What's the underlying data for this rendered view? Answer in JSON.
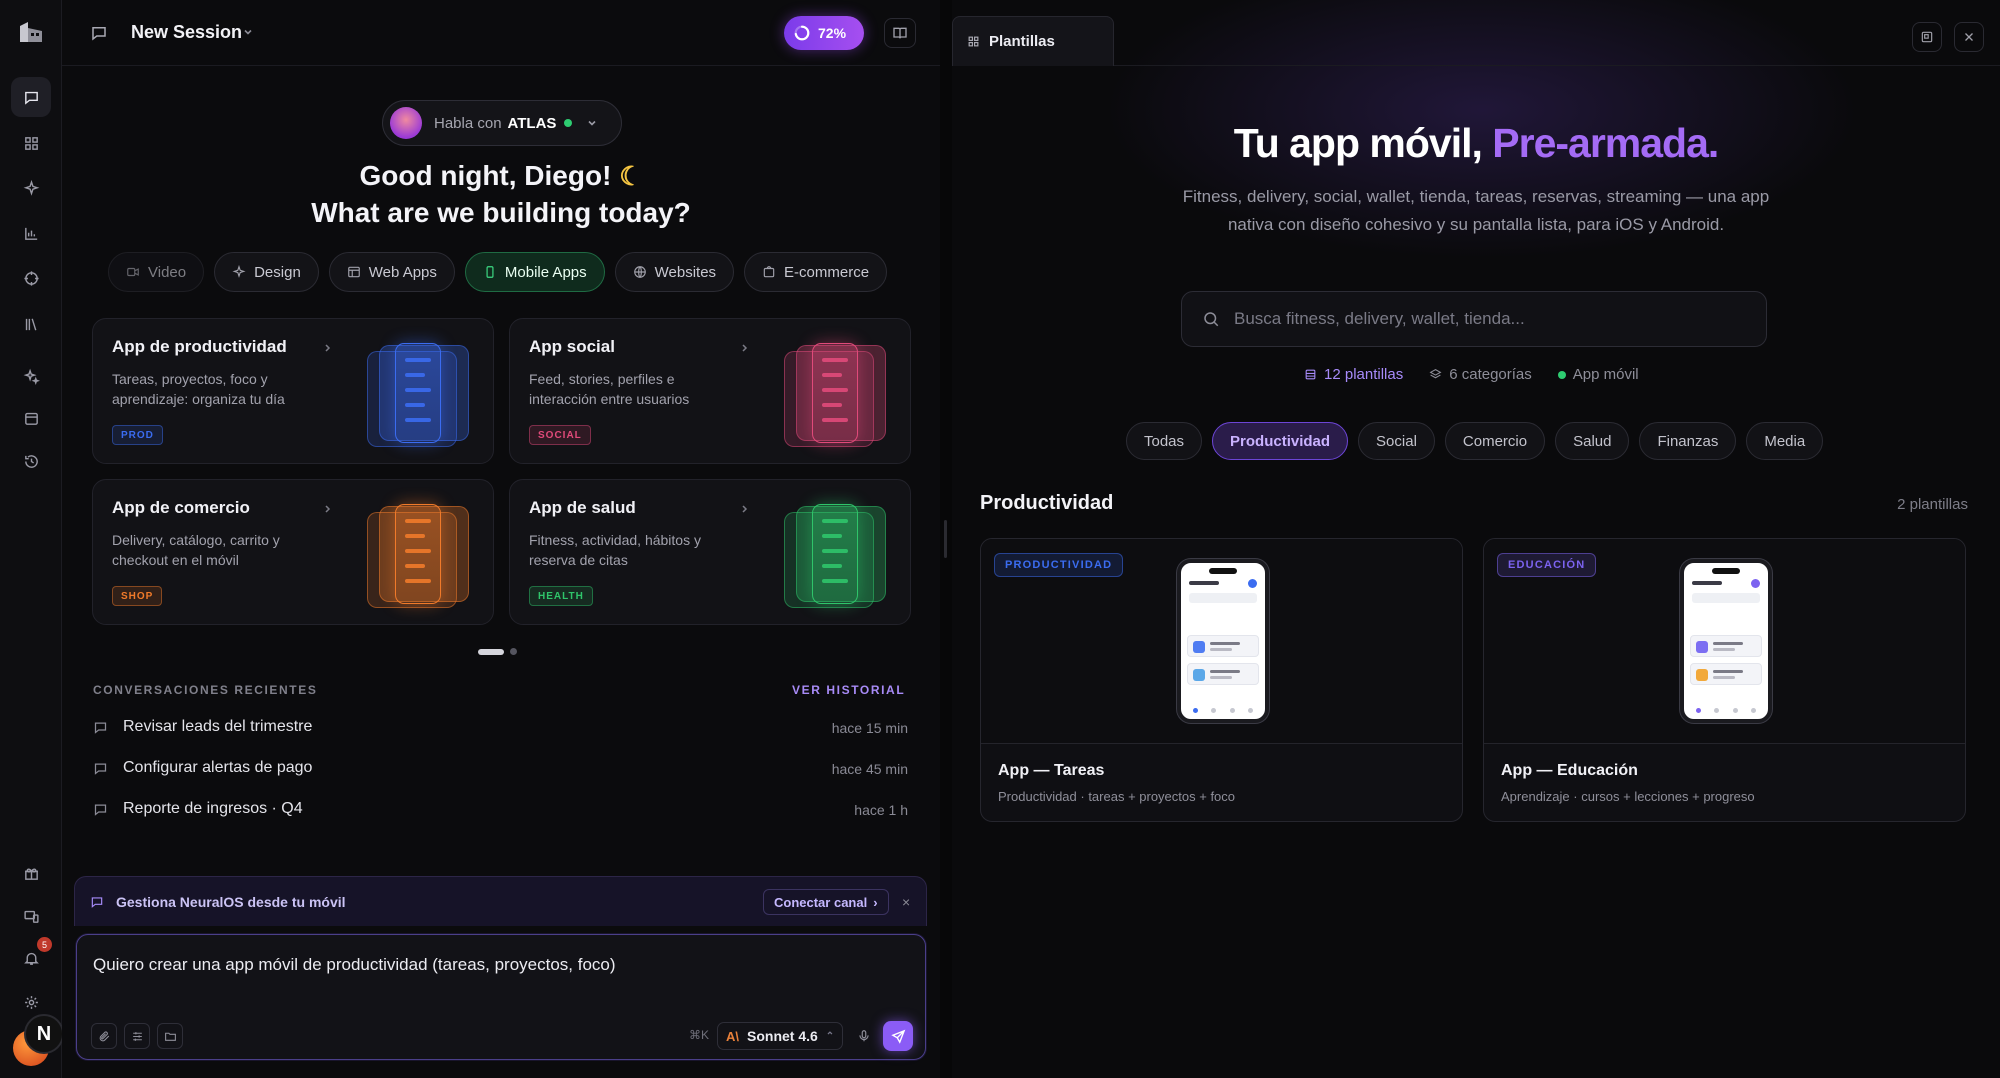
{
  "session": {
    "title": "New Session",
    "progress_label": "72%",
    "progress": 0.72
  },
  "agent": {
    "prefix": "Habla con",
    "name": "ATLAS"
  },
  "greeting": {
    "line1": "Good night, Diego!",
    "line2": "What are we building today?"
  },
  "categories": [
    {
      "label": "Video",
      "icon": "video-icon"
    },
    {
      "label": "Design",
      "icon": "sparkle-icon"
    },
    {
      "label": "Web Apps",
      "icon": "layout-icon"
    },
    {
      "label": "Mobile Apps",
      "icon": "phone-icon",
      "active": true
    },
    {
      "label": "Websites",
      "icon": "globe-icon"
    },
    {
      "label": "E-commerce",
      "icon": "cart-icon"
    }
  ],
  "cards": [
    {
      "title": "App de productividad",
      "desc": "Tareas, proyectos, foco y aprendizaje: organiza tu día",
      "tag": "PROD",
      "color": "#3b6cf0"
    },
    {
      "title": "App social",
      "desc": "Feed, stories, perfiles e interacción entre usuarios",
      "tag": "SOCIAL",
      "color": "#e04a7a"
    },
    {
      "title": "App de comercio",
      "desc": "Delivery, catálogo, carrito y checkout en el móvil",
      "tag": "SHOP",
      "color": "#f07a2a"
    },
    {
      "title": "App de salud",
      "desc": "Fitness, actividad, hábitos y reserva de citas",
      "tag": "HEALTH",
      "color": "#2fc46a"
    }
  ],
  "recent": {
    "heading": "CONVERSACIONES RECIENTES",
    "link": "VER HISTORIAL",
    "items": [
      {
        "text": "Revisar leads del trimestre",
        "time": "hace 15 min"
      },
      {
        "text": "Configurar alertas de pago",
        "time": "hace 45 min"
      },
      {
        "text": "Reporte de ingresos · Q4",
        "time": "hace 1 h"
      }
    ]
  },
  "banner": {
    "text": "Gestiona NeuralOS desde tu móvil",
    "button": "Conectar canal",
    "close": "×"
  },
  "composer": {
    "text": "Quiero crear una app móvil de productividad (tareas, proyectos, foco)",
    "kbd": "⌘K",
    "model_badge": "A\\",
    "model": "Sonnet 4.6"
  },
  "rail": {
    "notifications": "5",
    "user_initial": "N"
  },
  "templates": {
    "tab": "Plantillas",
    "hero_a": "Tu app móvil, ",
    "hero_b": "Pre-armada.",
    "subtitle": "Fitness, delivery, social, wallet, tienda, tareas, reservas, streaming — una app nativa con diseño cohesivo y su pantalla lista, para iOS y Android.",
    "search_placeholder": "Busca fitness, delivery, wallet, tienda...",
    "stats": [
      "12 plantillas",
      "6 categorías",
      "App móvil"
    ],
    "filters": [
      "Todas",
      "Productividad",
      "Social",
      "Comercio",
      "Salud",
      "Finanzas",
      "Media"
    ],
    "active_filter": "Productividad",
    "section": {
      "title": "Productividad",
      "count": "2 plantillas"
    },
    "items": [
      {
        "tag": "PRODUCTIVIDAD",
        "name": "App — Tareas",
        "desc": "Productividad · tareas + proyectos + foco",
        "accent": "#3b6cf0",
        "row_colors": [
          "#4f7cf2",
          "#5aa7e8"
        ]
      },
      {
        "tag": "EDUCACIÓN",
        "name": "App — Educación",
        "desc": "Aprendizaje · cursos + lecciones + progreso",
        "accent": "#7c63f0",
        "row_colors": [
          "#7c6ef2",
          "#f2a93b"
        ]
      }
    ]
  }
}
